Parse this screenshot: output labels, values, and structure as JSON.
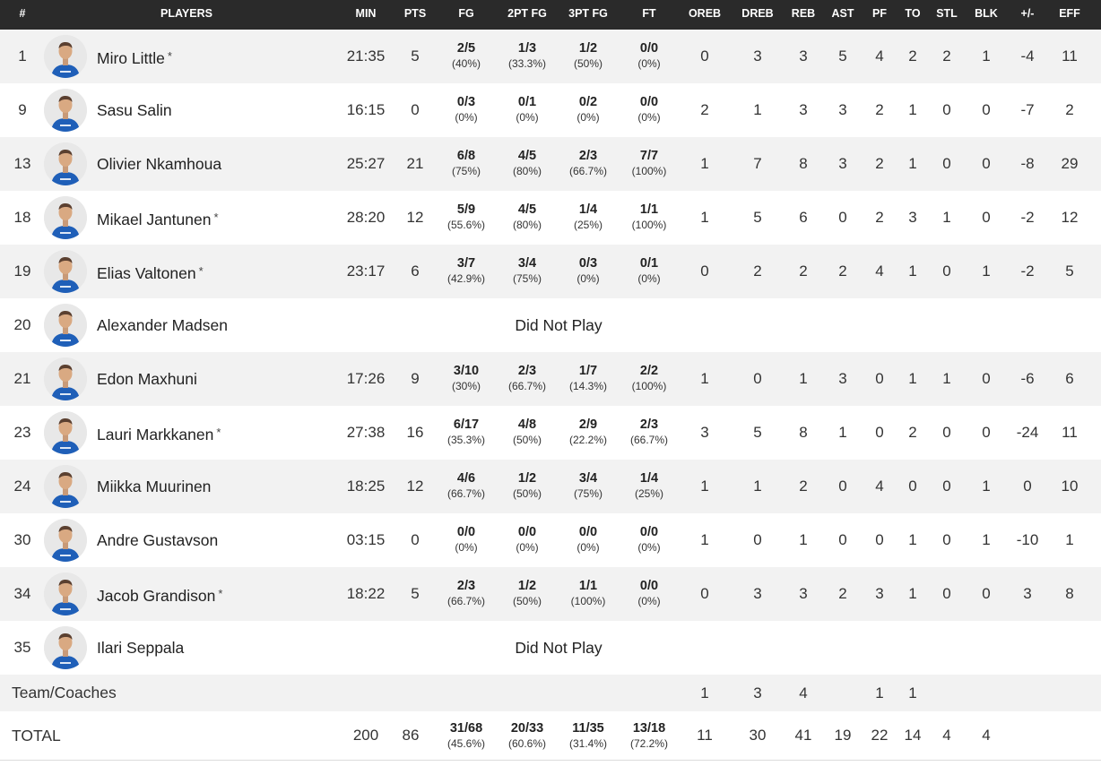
{
  "headers": {
    "num": "#",
    "players": "PLAYERS",
    "min": "MIN",
    "pts": "PTS",
    "fg": "FG",
    "fg2": "2PT FG",
    "fg3": "3PT FG",
    "ft": "FT",
    "oreb": "OREB",
    "dreb": "DREB",
    "reb": "REB",
    "ast": "AST",
    "pf": "PF",
    "to": "TO",
    "stl": "STL",
    "blk": "BLK",
    "pm": "+/-",
    "eff": "EFF"
  },
  "avatar_icon": "player-photo",
  "players": [
    {
      "num": "1",
      "name": "Miro Little",
      "starter": "*",
      "min": "21:35",
      "pts": "5",
      "fg": {
        "m": "2/5",
        "p": "(40%)"
      },
      "fg2": {
        "m": "1/3",
        "p": "(33.3%)"
      },
      "fg3": {
        "m": "1/2",
        "p": "(50%)"
      },
      "ft": {
        "m": "0/0",
        "p": "(0%)"
      },
      "oreb": "0",
      "dreb": "3",
      "reb": "3",
      "ast": "5",
      "pf": "4",
      "to": "2",
      "stl": "2",
      "blk": "1",
      "pm": "-4",
      "eff": "11"
    },
    {
      "num": "9",
      "name": "Sasu Salin",
      "min": "16:15",
      "pts": "0",
      "fg": {
        "m": "0/3",
        "p": "(0%)"
      },
      "fg2": {
        "m": "0/1",
        "p": "(0%)"
      },
      "fg3": {
        "m": "0/2",
        "p": "(0%)"
      },
      "ft": {
        "m": "0/0",
        "p": "(0%)"
      },
      "oreb": "2",
      "dreb": "1",
      "reb": "3",
      "ast": "3",
      "pf": "2",
      "to": "1",
      "stl": "0",
      "blk": "0",
      "pm": "-7",
      "eff": "2"
    },
    {
      "num": "13",
      "name": "Olivier Nkamhoua",
      "min": "25:27",
      "pts": "21",
      "fg": {
        "m": "6/8",
        "p": "(75%)"
      },
      "fg2": {
        "m": "4/5",
        "p": "(80%)"
      },
      "fg3": {
        "m": "2/3",
        "p": "(66.7%)"
      },
      "ft": {
        "m": "7/7",
        "p": "(100%)"
      },
      "oreb": "1",
      "dreb": "7",
      "reb": "8",
      "ast": "3",
      "pf": "2",
      "to": "1",
      "stl": "0",
      "blk": "0",
      "pm": "-8",
      "eff": "29"
    },
    {
      "num": "18",
      "name": "Mikael Jantunen",
      "starter": "*",
      "min": "28:20",
      "pts": "12",
      "fg": {
        "m": "5/9",
        "p": "(55.6%)"
      },
      "fg2": {
        "m": "4/5",
        "p": "(80%)"
      },
      "fg3": {
        "m": "1/4",
        "p": "(25%)"
      },
      "ft": {
        "m": "1/1",
        "p": "(100%)"
      },
      "oreb": "1",
      "dreb": "5",
      "reb": "6",
      "ast": "0",
      "pf": "2",
      "to": "3",
      "stl": "1",
      "blk": "0",
      "pm": "-2",
      "eff": "12"
    },
    {
      "num": "19",
      "name": "Elias Valtonen",
      "starter": "*",
      "min": "23:17",
      "pts": "6",
      "fg": {
        "m": "3/7",
        "p": "(42.9%)"
      },
      "fg2": {
        "m": "3/4",
        "p": "(75%)"
      },
      "fg3": {
        "m": "0/3",
        "p": "(0%)"
      },
      "ft": {
        "m": "0/1",
        "p": "(0%)"
      },
      "oreb": "0",
      "dreb": "2",
      "reb": "2",
      "ast": "2",
      "pf": "4",
      "to": "1",
      "stl": "0",
      "blk": "1",
      "pm": "-2",
      "eff": "5"
    },
    {
      "num": "20",
      "name": "Alexander Madsen",
      "dnp": "Did Not Play"
    },
    {
      "num": "21",
      "name": "Edon Maxhuni",
      "min": "17:26",
      "pts": "9",
      "fg": {
        "m": "3/10",
        "p": "(30%)"
      },
      "fg2": {
        "m": "2/3",
        "p": "(66.7%)"
      },
      "fg3": {
        "m": "1/7",
        "p": "(14.3%)"
      },
      "ft": {
        "m": "2/2",
        "p": "(100%)"
      },
      "oreb": "1",
      "dreb": "0",
      "reb": "1",
      "ast": "3",
      "pf": "0",
      "to": "1",
      "stl": "1",
      "blk": "0",
      "pm": "-6",
      "eff": "6"
    },
    {
      "num": "23",
      "name": "Lauri Markkanen",
      "starter": "*",
      "min": "27:38",
      "pts": "16",
      "fg": {
        "m": "6/17",
        "p": "(35.3%)"
      },
      "fg2": {
        "m": "4/8",
        "p": "(50%)"
      },
      "fg3": {
        "m": "2/9",
        "p": "(22.2%)"
      },
      "ft": {
        "m": "2/3",
        "p": "(66.7%)"
      },
      "oreb": "3",
      "dreb": "5",
      "reb": "8",
      "ast": "1",
      "pf": "0",
      "to": "2",
      "stl": "0",
      "blk": "0",
      "pm": "-24",
      "eff": "11"
    },
    {
      "num": "24",
      "name": "Miikka Muurinen",
      "min": "18:25",
      "pts": "12",
      "fg": {
        "m": "4/6",
        "p": "(66.7%)"
      },
      "fg2": {
        "m": "1/2",
        "p": "(50%)"
      },
      "fg3": {
        "m": "3/4",
        "p": "(75%)"
      },
      "ft": {
        "m": "1/4",
        "p": "(25%)"
      },
      "oreb": "1",
      "dreb": "1",
      "reb": "2",
      "ast": "0",
      "pf": "4",
      "to": "0",
      "stl": "0",
      "blk": "1",
      "pm": "0",
      "eff": "10"
    },
    {
      "num": "30",
      "name": "Andre Gustavson",
      "min": "03:15",
      "pts": "0",
      "fg": {
        "m": "0/0",
        "p": "(0%)"
      },
      "fg2": {
        "m": "0/0",
        "p": "(0%)"
      },
      "fg3": {
        "m": "0/0",
        "p": "(0%)"
      },
      "ft": {
        "m": "0/0",
        "p": "(0%)"
      },
      "oreb": "1",
      "dreb": "0",
      "reb": "1",
      "ast": "0",
      "pf": "0",
      "to": "1",
      "stl": "0",
      "blk": "1",
      "pm": "-10",
      "eff": "1"
    },
    {
      "num": "34",
      "name": "Jacob Grandison",
      "starter": "*",
      "min": "18:22",
      "pts": "5",
      "fg": {
        "m": "2/3",
        "p": "(66.7%)"
      },
      "fg2": {
        "m": "1/2",
        "p": "(50%)"
      },
      "fg3": {
        "m": "1/1",
        "p": "(100%)"
      },
      "ft": {
        "m": "0/0",
        "p": "(0%)"
      },
      "oreb": "0",
      "dreb": "3",
      "reb": "3",
      "ast": "2",
      "pf": "3",
      "to": "1",
      "stl": "0",
      "blk": "0",
      "pm": "3",
      "eff": "8"
    },
    {
      "num": "35",
      "name": "Ilari Seppala",
      "dnp": "Did Not Play"
    }
  ],
  "team": {
    "label": "Team/Coaches",
    "oreb": "1",
    "dreb": "3",
    "reb": "4",
    "pf": "1",
    "to": "1"
  },
  "total": {
    "label": "TOTAL",
    "min": "200",
    "pts": "86",
    "fg": {
      "m": "31/68",
      "p": "(45.6%)"
    },
    "fg2": {
      "m": "20/33",
      "p": "(60.6%)"
    },
    "fg3": {
      "m": "11/35",
      "p": "(31.4%)"
    },
    "ft": {
      "m": "13/18",
      "p": "(72.2%)"
    },
    "oreb": "11",
    "dreb": "30",
    "reb": "41",
    "ast": "19",
    "pf": "22",
    "to": "14",
    "stl": "4",
    "blk": "4"
  },
  "colors": {
    "header_bg": "#2a2a2a",
    "alt_row": "#f2f2f2",
    "jersey": "#1f5fb8"
  }
}
